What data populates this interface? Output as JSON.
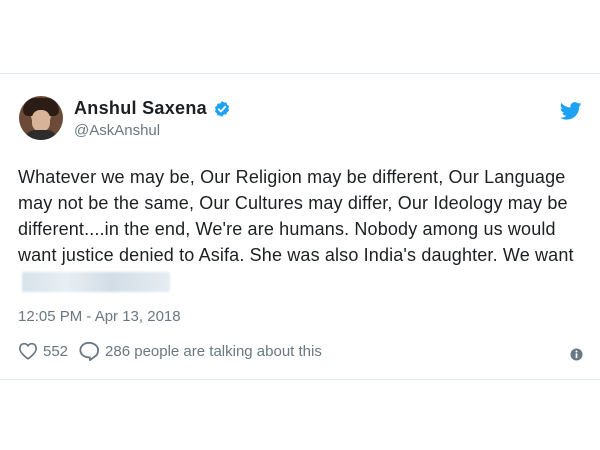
{
  "user": {
    "display_name": "Anshul Saxena",
    "handle": "@AskAnshul",
    "verified": true
  },
  "tweet": {
    "text": "Whatever we may be, Our Religion may be different, Our Language may not be the same, Our Cultures may differ, Our Ideology may be different....in the end, We're are humans. Nobody among us would want justice denied to Asifa. She was also India's daughter. We want",
    "timestamp": "12:05 PM - Apr 13, 2018"
  },
  "actions": {
    "likes": "552",
    "conversation": "286 people are talking about this"
  },
  "colors": {
    "twitter_blue": "#1da1f2",
    "text_primary": "#1c2022",
    "text_secondary": "#697882"
  },
  "icons": {
    "verified": "verified-badge-icon",
    "brand": "twitter-bird-icon",
    "like": "heart-icon",
    "reply": "speech-bubble-icon",
    "info": "info-icon"
  }
}
